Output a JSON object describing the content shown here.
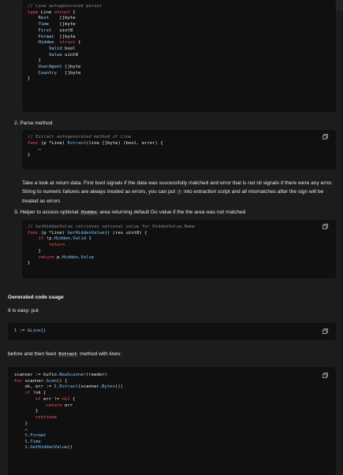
{
  "code_blocks": {
    "struct_block": {
      "lines": [
        [
          {
            "t": "// Line autogenerated parser",
            "c": "cm"
          }
        ],
        [
          {
            "t": "type ",
            "c": "kw"
          },
          {
            "t": "Line ",
            "c": ""
          },
          {
            "t": "struct",
            "c": "kw"
          },
          {
            "t": " {",
            "c": ""
          }
        ],
        [
          {
            "t": "    Rest    ",
            "c": "ty"
          },
          {
            "t": "[]byte",
            "c": ""
          }
        ],
        [
          {
            "t": "    Time    ",
            "c": "ty"
          },
          {
            "t": "[]byte",
            "c": ""
          }
        ],
        [
          {
            "t": "    First   ",
            "c": "ty"
          },
          {
            "t": "uint8",
            "c": ""
          }
        ],
        [
          {
            "t": "    Format  ",
            "c": "ty"
          },
          {
            "t": "[]byte",
            "c": ""
          }
        ],
        [
          {
            "t": "    Hidden  ",
            "c": "ty"
          },
          {
            "t": "struct",
            "c": "kw"
          },
          {
            "t": " {",
            "c": ""
          }
        ],
        [
          {
            "t": "        Valid ",
            "c": "ty"
          },
          {
            "t": "bool",
            "c": ""
          }
        ],
        [
          {
            "t": "        Value ",
            "c": "ty"
          },
          {
            "t": "uint8",
            "c": ""
          }
        ],
        [
          {
            "t": "    }",
            "c": ""
          }
        ],
        [
          {
            "t": "    UserAgent ",
            "c": "ty"
          },
          {
            "t": "[]byte",
            "c": ""
          }
        ],
        [
          {
            "t": "    Country   ",
            "c": "ty"
          },
          {
            "t": "[]byte",
            "c": ""
          }
        ],
        [
          {
            "t": "}",
            "c": ""
          }
        ]
      ]
    },
    "extract_block": {
      "lines": [
        [
          {
            "t": "// Extract autogenerated method of Line",
            "c": "cm"
          }
        ],
        [
          {
            "t": "func ",
            "c": "kw"
          },
          {
            "t": "(p *Line) ",
            "c": ""
          },
          {
            "t": "Extract",
            "c": "fn"
          },
          {
            "t": "(line []byte) (bool, error) {",
            "c": ""
          }
        ],
        [
          {
            "t": "    …",
            "c": ""
          }
        ],
        [
          {
            "t": "}",
            "c": ""
          }
        ]
      ]
    },
    "hidden_block": {
      "lines": [
        [
          {
            "t": "// GetHiddenValue retrieves optional value for HiddenValue.Name",
            "c": "cm"
          }
        ],
        [
          {
            "t": "func ",
            "c": "kw"
          },
          {
            "t": "(p *Line) ",
            "c": ""
          },
          {
            "t": "GetHiddenValue",
            "c": "fn"
          },
          {
            "t": "() (res uint8) {",
            "c": ""
          }
        ],
        [
          {
            "t": "    if ",
            "c": "kw"
          },
          {
            "t": "!p.",
            "c": ""
          },
          {
            "t": "Hidden",
            "c": "fn"
          },
          {
            "t": ".",
            "c": ""
          },
          {
            "t": "Valid",
            "c": "fn"
          },
          {
            "t": " {",
            "c": ""
          }
        ],
        [
          {
            "t": "        return",
            "c": "kw"
          }
        ],
        [
          {
            "t": "    }",
            "c": ""
          }
        ],
        [
          {
            "t": "    return ",
            "c": "kw"
          },
          {
            "t": "p.",
            "c": ""
          },
          {
            "t": "Hidden",
            "c": "fn"
          },
          {
            "t": ".",
            "c": ""
          },
          {
            "t": "Value",
            "c": "fn"
          }
        ],
        [
          {
            "t": "}",
            "c": ""
          }
        ]
      ]
    },
    "usage_block": {
      "lines": [
        [
          {
            "t": "l := ",
            "c": ""
          },
          {
            "t": "&Line{}",
            "c": "fn"
          }
        ]
      ]
    },
    "scanner_block": {
      "lines": [
        [
          {
            "t": "scanner := bufio.",
            "c": ""
          },
          {
            "t": "NewScanner",
            "c": "fn"
          },
          {
            "t": "(reader)",
            "c": ""
          }
        ],
        [
          {
            "t": "for ",
            "c": "kw"
          },
          {
            "t": "scanner.",
            "c": ""
          },
          {
            "t": "Scan",
            "c": "fn"
          },
          {
            "t": "() {",
            "c": ""
          }
        ],
        [
          {
            "t": "    ok, err := l.",
            "c": ""
          },
          {
            "t": "Extract",
            "c": "fn"
          },
          {
            "t": "(scanner.",
            "c": ""
          },
          {
            "t": "Bytes",
            "c": "fn"
          },
          {
            "t": "())",
            "c": ""
          }
        ],
        [
          {
            "t": "    if ",
            "c": "kw"
          },
          {
            "t": "!ok {",
            "c": ""
          }
        ],
        [
          {
            "t": "        if ",
            "c": "kw"
          },
          {
            "t": "err != ",
            "c": ""
          },
          {
            "t": "nil",
            "c": "kw"
          },
          {
            "t": " {",
            "c": ""
          }
        ],
        [
          {
            "t": "            return ",
            "c": "kw"
          },
          {
            "t": "err",
            "c": ""
          }
        ],
        [
          {
            "t": "        }",
            "c": ""
          }
        ],
        [
          {
            "t": "        continue",
            "c": "kw"
          }
        ],
        [
          {
            "t": "    }",
            "c": ""
          }
        ],
        [
          {
            "t": "    …",
            "c": ""
          }
        ],
        [
          {
            "t": "    l.",
            "c": ""
          },
          {
            "t": "Format",
            "c": "fn"
          }
        ],
        [
          {
            "t": "    l.",
            "c": ""
          },
          {
            "t": "Time",
            "c": "fn"
          }
        ],
        [
          {
            "t": "    l.",
            "c": ""
          },
          {
            "t": "GetHiddenValue",
            "c": "fn"
          },
          {
            "t": "()",
            "c": ""
          }
        ]
      ]
    }
  },
  "list": {
    "item2": "2. Parse method",
    "item3_pre": "3. Helper to access optional ",
    "item3_code": "Hidden",
    "item3_post": " area returning default Go value if the the area was not matched"
  },
  "paragraph1": {
    "pre": "Take a look at return data. First bool signals if the data was successfully matched and error that is not nil signals if there were any error. String to numeric failures are always treated as errors, you can put ",
    "code": "!",
    "post": " into extraction script and all mismatches after the sign will be treated as errors"
  },
  "heading_usage": "Generated code usage",
  "text_easy": "It is easy: put",
  "text_before": {
    "pre": "before and then feed ",
    "code": "Extract",
    "post": " method with lines:"
  },
  "icons": {
    "copy": "copy-icon"
  }
}
